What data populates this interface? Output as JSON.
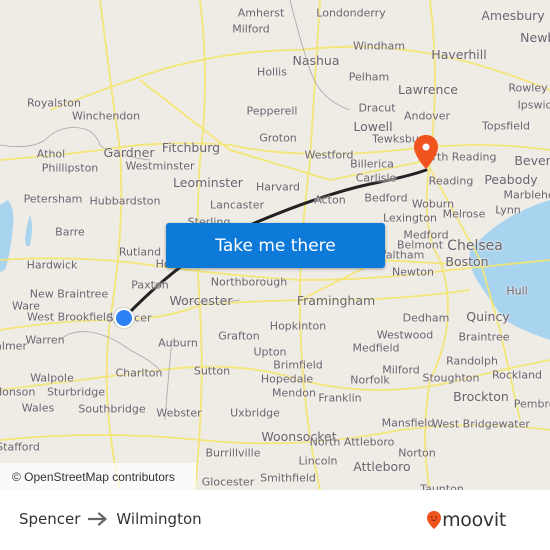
{
  "map": {
    "attribution": "© OpenStreetMap contributors",
    "cta_label": "Take me there",
    "origin_marker": {
      "icon": "origin-dot-icon",
      "color": "#2c82f2",
      "place": "Spencer"
    },
    "destination_marker": {
      "icon": "map-pin-icon",
      "color": "#f1531f",
      "place": "Wilmington"
    },
    "route_line_color": "#222222",
    "colors": {
      "land": "#efece6",
      "roads": "#f7e96a",
      "water": "#a9d4f0",
      "cta": "#0d79d8"
    },
    "places": [
      {
        "name": "Amherst"
      },
      {
        "name": "Milford"
      },
      {
        "name": "Londonderry"
      },
      {
        "name": "Amesbury"
      },
      {
        "name": "Newbury"
      },
      {
        "name": "Windham"
      },
      {
        "name": "Haverhill"
      },
      {
        "name": "Nashua"
      },
      {
        "name": "Hollis"
      },
      {
        "name": "Pelham"
      },
      {
        "name": "Royalston"
      },
      {
        "name": "Winchendon"
      },
      {
        "name": "Rowley"
      },
      {
        "name": "Ipswich"
      },
      {
        "name": "Lawrence"
      },
      {
        "name": "Dracut"
      },
      {
        "name": "Pepperell"
      },
      {
        "name": "Andover"
      },
      {
        "name": "Topsfield"
      },
      {
        "name": "Lowell"
      },
      {
        "name": "Groton"
      },
      {
        "name": "Tewksbury"
      },
      {
        "name": "Athol"
      },
      {
        "name": "Gardner"
      },
      {
        "name": "Fitchburg"
      },
      {
        "name": "North Reading"
      },
      {
        "name": "Beverly"
      },
      {
        "name": "Westminster"
      },
      {
        "name": "Phillipston"
      },
      {
        "name": "Westford"
      },
      {
        "name": "Billerica"
      },
      {
        "name": "Peabody"
      },
      {
        "name": "Leominster"
      },
      {
        "name": "Harvard"
      },
      {
        "name": "Carlisle"
      },
      {
        "name": "Reading"
      },
      {
        "name": "Marblehead"
      },
      {
        "name": "Petersham"
      },
      {
        "name": "Hubbardston"
      },
      {
        "name": "Lancaster"
      },
      {
        "name": "Acton"
      },
      {
        "name": "Bedford"
      },
      {
        "name": "Woburn"
      },
      {
        "name": "Melrose"
      },
      {
        "name": "Lynn"
      },
      {
        "name": "Sterling"
      },
      {
        "name": "Lexington"
      },
      {
        "name": "Barre"
      },
      {
        "name": "Medford"
      },
      {
        "name": "Belmont"
      },
      {
        "name": "Chelsea"
      },
      {
        "name": "Rutland"
      },
      {
        "name": "Waltham"
      },
      {
        "name": "Hardwick"
      },
      {
        "name": "Holden"
      },
      {
        "name": "Boston"
      },
      {
        "name": "New Braintree"
      },
      {
        "name": "Northborough"
      },
      {
        "name": "Newton"
      },
      {
        "name": "Paxton"
      },
      {
        "name": "Hull"
      },
      {
        "name": "Ware"
      },
      {
        "name": "West Brookfield"
      },
      {
        "name": "Worcester"
      },
      {
        "name": "Framingham"
      },
      {
        "name": "Spencer"
      },
      {
        "name": "Hopkinton"
      },
      {
        "name": "Dedham"
      },
      {
        "name": "Quincy"
      },
      {
        "name": "Palmer"
      },
      {
        "name": "Warren"
      },
      {
        "name": "Grafton"
      },
      {
        "name": "Westwood"
      },
      {
        "name": "Auburn"
      },
      {
        "name": "Medfield"
      },
      {
        "name": "Braintree"
      },
      {
        "name": "Upton"
      },
      {
        "name": "Randolph"
      },
      {
        "name": "Charlton"
      },
      {
        "name": "Sutton"
      },
      {
        "name": "Brimfield"
      },
      {
        "name": "Milford"
      },
      {
        "name": "Walpole"
      },
      {
        "name": "Hopedale"
      },
      {
        "name": "Norfolk"
      },
      {
        "name": "Stoughton"
      },
      {
        "name": "Rockland"
      },
      {
        "name": "Sturbridge"
      },
      {
        "name": "Monson"
      },
      {
        "name": "Mendon"
      },
      {
        "name": "Franklin"
      },
      {
        "name": "Brockton"
      },
      {
        "name": "Wales"
      },
      {
        "name": "Southbridge"
      },
      {
        "name": "Webster"
      },
      {
        "name": "Uxbridge"
      },
      {
        "name": "Pembroke"
      },
      {
        "name": "Mansfield"
      },
      {
        "name": "West Bridgewater"
      },
      {
        "name": "Stafford"
      },
      {
        "name": "Woonsocket"
      },
      {
        "name": "North Attleboro"
      },
      {
        "name": "Norton"
      },
      {
        "name": "Burrillville"
      },
      {
        "name": "Lincoln"
      },
      {
        "name": "Attleboro"
      },
      {
        "name": "Glocester"
      },
      {
        "name": "Smithfield"
      },
      {
        "name": "Taunton"
      }
    ]
  },
  "footer": {
    "origin": "Spencer",
    "destination": "Wilmington",
    "arrow_icon": "arrow-right-icon",
    "brand": "moovit",
    "brand_color": "#f1531f"
  }
}
